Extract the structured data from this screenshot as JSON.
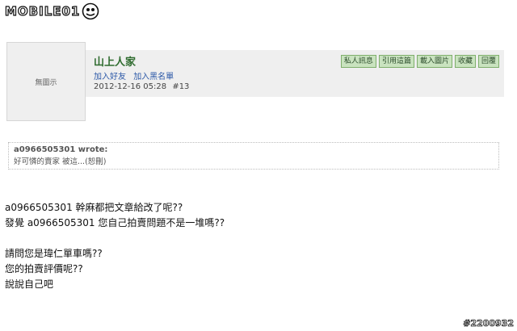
{
  "logo": {
    "text": "MOBILE01"
  },
  "avatar": {
    "label": "無圖示"
  },
  "post": {
    "username": "山上人家",
    "links": [
      "加入好友",
      "加入黑名單"
    ],
    "date": "2012-12-16 05:28",
    "floor": "#13",
    "actions": [
      "私人訊息",
      "引用這篇",
      "載入圖片",
      "收藏",
      "回覆"
    ]
  },
  "quote": {
    "author": "a0966505301 wrote:",
    "text": "好可憐的賣家 被這...(恕刪)"
  },
  "body": {
    "lines": [
      "a0966505301 幹麻都把文章給改了呢??",
      "發覺 a0966505301 您自己拍賣問題不是一堆嗎??",
      "",
      "請問您是瑋仁單車嗎??",
      "您的拍賣評價呢??",
      "說說自己吧"
    ]
  },
  "watermark": {
    "text": "#2200932"
  },
  "colors": {
    "header_bg": "#efefef",
    "username": "#2e6b2e",
    "link": "#2e5aa8",
    "button_bg": "#c9e3bf"
  }
}
